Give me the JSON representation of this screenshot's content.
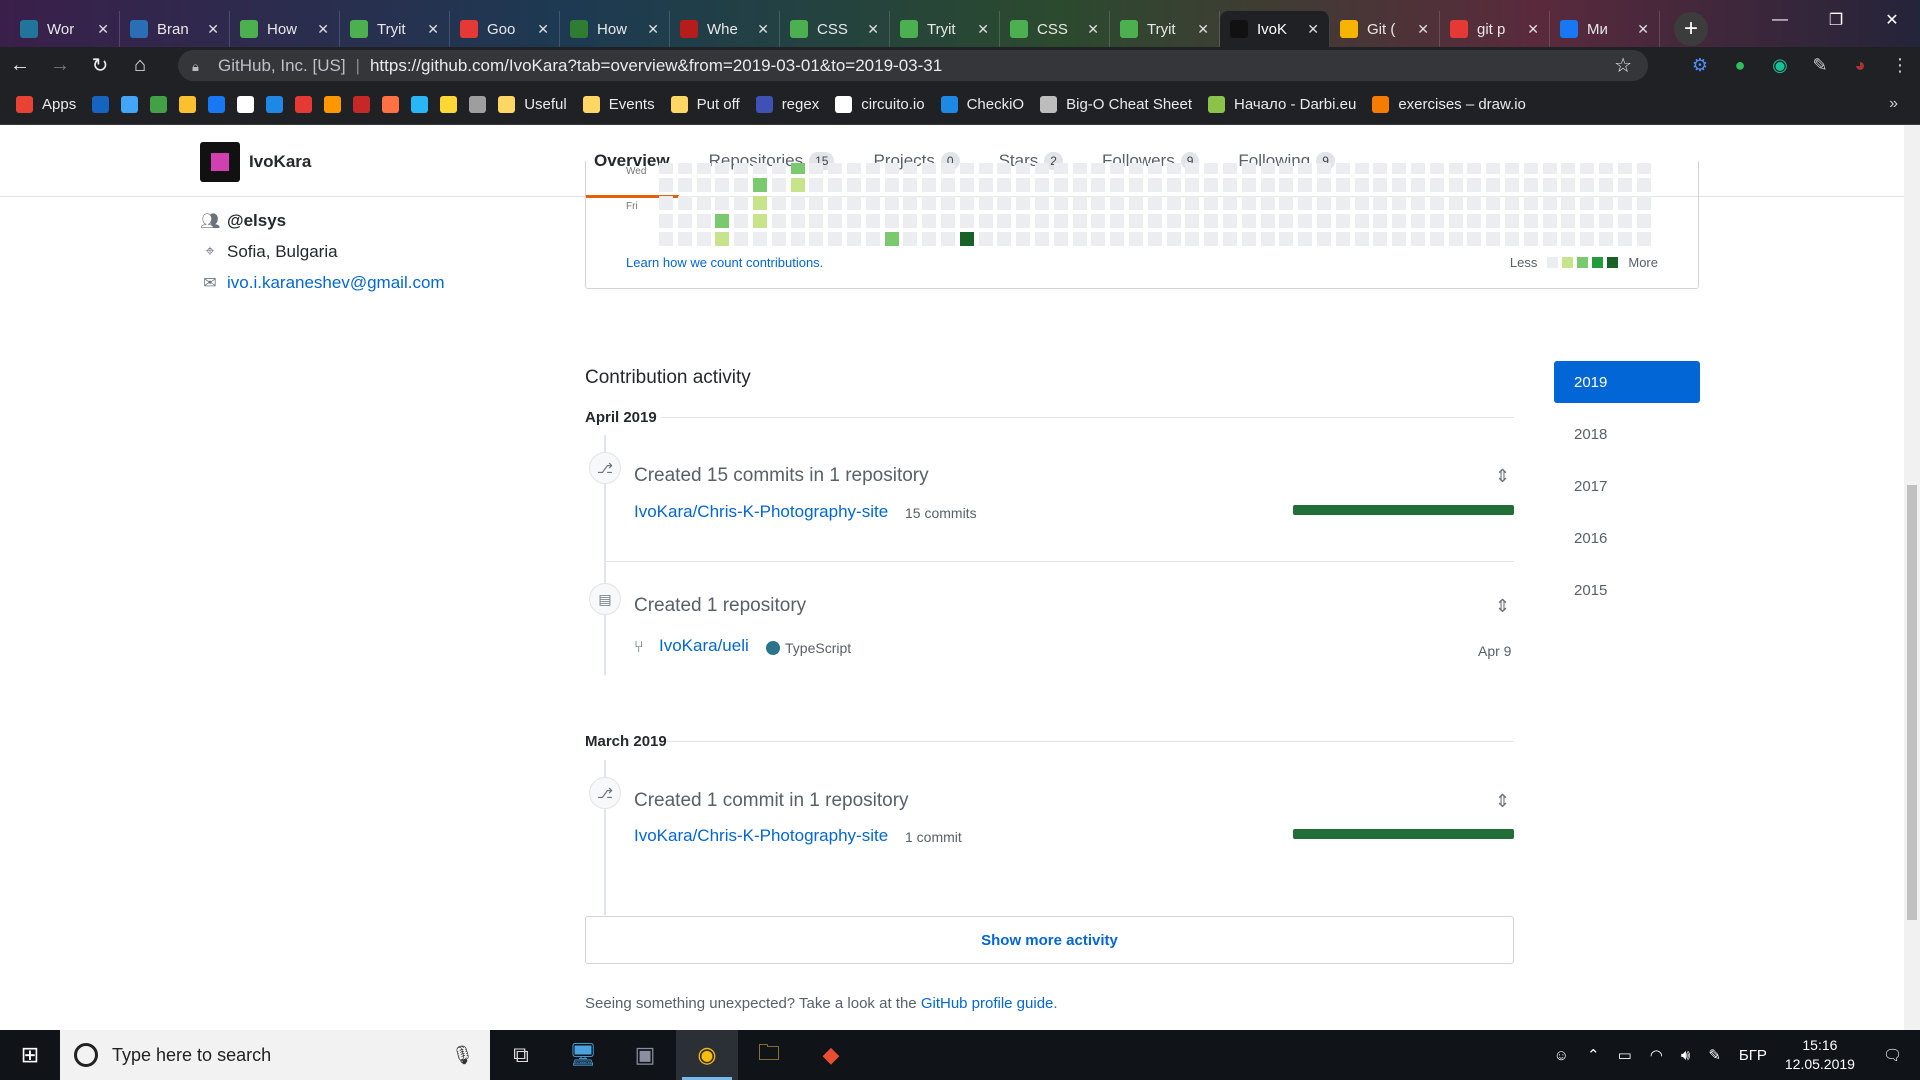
{
  "browser": {
    "tabs": [
      {
        "label": "Wor",
        "color": "#21759b",
        "active": false
      },
      {
        "label": "Bran",
        "color": "#2a6fb5",
        "active": false
      },
      {
        "label": "How",
        "color": "#4caf50",
        "active": false
      },
      {
        "label": "Tryit",
        "color": "#4caf50",
        "active": false
      },
      {
        "label": "Goo",
        "color": "#e53935",
        "active": false
      },
      {
        "label": "How",
        "color": "#2e7d32",
        "active": false
      },
      {
        "label": "Whe",
        "color": "#b71c1c",
        "active": false
      },
      {
        "label": "CSS",
        "color": "#4caf50",
        "active": false
      },
      {
        "label": "Tryit",
        "color": "#4caf50",
        "active": false
      },
      {
        "label": "CSS",
        "color": "#4caf50",
        "active": false
      },
      {
        "label": "Tryit",
        "color": "#4caf50",
        "active": false
      },
      {
        "label": "IvoK",
        "color": "#111111",
        "active": true
      },
      {
        "label": "Git (",
        "color": "#f4b400",
        "active": false
      },
      {
        "label": "git p",
        "color": "#e53935",
        "active": false
      },
      {
        "label": "Ми",
        "color": "#1877f2",
        "active": false
      }
    ],
    "url_site": "GitHub, Inc. [US]",
    "url_sep": "|",
    "url": "https://github.com/IvoKara?tab=overview&from=2019-03-01&to=2019-03-31",
    "bookmarks": [
      {
        "label": "Apps",
        "color": "#e94235"
      },
      {
        "label": "",
        "color": "#1565c0"
      },
      {
        "label": "",
        "color": "#42a5f5"
      },
      {
        "label": "",
        "color": "#43a047"
      },
      {
        "label": "",
        "color": "#fbc02d"
      },
      {
        "label": "",
        "color": "#1877f2"
      },
      {
        "label": "",
        "color": "#ffffff"
      },
      {
        "label": "",
        "color": "#1e88e5"
      },
      {
        "label": "",
        "color": "#e53935"
      },
      {
        "label": "",
        "color": "#ff9800"
      },
      {
        "label": "",
        "color": "#c62828"
      },
      {
        "label": "",
        "color": "#ff7043"
      },
      {
        "label": "",
        "color": "#29b6f6"
      },
      {
        "label": "",
        "color": "#fdd835"
      },
      {
        "label": "",
        "color": "#9e9e9e"
      },
      {
        "label": "Useful",
        "color": "#fdd663"
      },
      {
        "label": "Events",
        "color": "#fdd663"
      },
      {
        "label": "Put off",
        "color": "#fdd663"
      },
      {
        "label": "regex",
        "color": "#3f51b5"
      },
      {
        "label": "circuito.io",
        "color": "#ffffff"
      },
      {
        "label": "CheckiO",
        "color": "#1e88e5"
      },
      {
        "label": "Big-O Cheat Sheet",
        "color": "#bdbdbd"
      },
      {
        "label": "Начало - Darbi.eu",
        "color": "#8bc34a"
      },
      {
        "label": "exercises – draw.io",
        "color": "#f57c00"
      }
    ],
    "more": "»"
  },
  "github": {
    "username": "IvoKara",
    "nav": [
      {
        "label": "Overview",
        "count": "",
        "active": true
      },
      {
        "label": "Repositories",
        "count": "15",
        "active": false
      },
      {
        "label": "Projects",
        "count": "0",
        "active": false
      },
      {
        "label": "Stars",
        "count": "2",
        "active": false
      },
      {
        "label": "Followers",
        "count": "9",
        "active": false
      },
      {
        "label": "Following",
        "count": "9",
        "active": false
      }
    ],
    "org": "@elsys",
    "location": "Sofia, Bulgaria",
    "email": "ivo.i.karaneshev@gmail.com"
  },
  "calendar": {
    "day_wed": "Wed",
    "day_fri": "Fri",
    "link": "Learn how we count contributions.",
    "less": "Less",
    "more": "More",
    "levels": [
      "#ebedf0",
      "#c6e48b",
      "#7bc96f",
      "#239a3b",
      "#196127"
    ],
    "highlights": [
      {
        "col": 7,
        "row": 2,
        "level": 2
      },
      {
        "col": 5,
        "row": 3,
        "level": 2
      },
      {
        "col": 7,
        "row": 3,
        "level": 1
      },
      {
        "col": 5,
        "row": 4,
        "level": 1
      },
      {
        "col": 3,
        "row": 5,
        "level": 2
      },
      {
        "col": 5,
        "row": 5,
        "level": 1
      },
      {
        "col": 3,
        "row": 6,
        "level": 1
      },
      {
        "col": 12,
        "row": 6,
        "level": 2
      },
      {
        "col": 16,
        "row": 6,
        "level": 4
      }
    ]
  },
  "activity": {
    "title": "Contribution activity",
    "month1": "April 2019",
    "ev1_title": "Created 15 commits in 1 repository",
    "ev1_repo": "IvoKara/Chris-K-Photography-site",
    "ev1_count": "15 commits",
    "ev1_bar_fraction": 1.0,
    "ev2_title": "Created 1 repository",
    "ev2_repo": "IvoKara/ueli",
    "ev2_lang": "TypeScript",
    "ev2_lang_color": "#2b7489",
    "ev2_date": "Apr 9",
    "month2": "March 2019",
    "ev3_title": "Created 1 commit in 1 repository",
    "ev3_repo": "IvoKara/Chris-K-Photography-site",
    "ev3_count": "1 commit",
    "ev3_bar_fraction": 1.0,
    "show_more": "Show more activity",
    "footer_text": "Seeing something unexpected? Take a look at the",
    "footer_link": "GitHub profile guide",
    "footer_end": "."
  },
  "years": [
    "2019",
    "2018",
    "2017",
    "2016",
    "2015"
  ],
  "taskbar": {
    "search_placeholder": "Type here to search",
    "lang": "БГР",
    "time": "15:16",
    "date": "12.05.2019"
  }
}
